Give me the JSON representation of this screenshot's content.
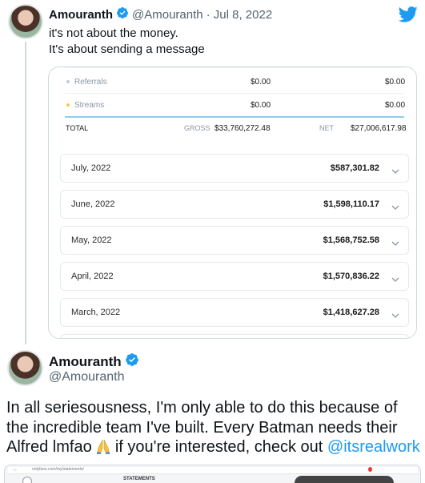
{
  "tweet1": {
    "name": "Amouranth",
    "handle": "@Amouranth",
    "date": "· Jul 8, 2022",
    "text_line1": "it's not about the money.",
    "text_line2": "It's about sending a message"
  },
  "card": {
    "rows": [
      {
        "label": "Referrals",
        "value1": "$0.00",
        "value2": "$0.00",
        "dot_color": "#c6ccd2"
      },
      {
        "label": "Streams",
        "value1": "$0.00",
        "value2": "$0.00",
        "dot_color": "#f4c84d"
      }
    ],
    "total": {
      "label": "TOTAL",
      "gross_label": "GROSS",
      "gross_value": "$33,760,272.48",
      "net_label": "NET",
      "net_value": "$27,006,617.98"
    },
    "months": [
      {
        "label": "July, 2022",
        "value": "$587,301.82"
      },
      {
        "label": "June, 2022",
        "value": "$1,598,110.17"
      },
      {
        "label": "May, 2022",
        "value": "$1,568,752.58"
      },
      {
        "label": "April, 2022",
        "value": "$1,570,836.22"
      },
      {
        "label": "March, 2022",
        "value": "$1,418,627.28"
      }
    ]
  },
  "tweet2": {
    "name": "Amouranth",
    "handle": "@Amouranth",
    "text_part1": "In all seriesousness, I'm only able to do this because of the incredible team I've built. Every Batman needs their Alfred lmfao",
    "text_part2": " if you're interested, check out ",
    "mention": "@itsrealwork"
  },
  "embedded_screenshot": {
    "url": "onlyfans.com/my/statements/",
    "heading": "STATEMENTS"
  },
  "colors": {
    "accent": "#1d9bf0",
    "verified": "#1d9bf0",
    "total_line": "#8ad0f3"
  },
  "icons": {
    "verified": "verified-badge-icon",
    "twitter": "twitter-bird-icon",
    "chevron": "chevron-down-icon",
    "emoji": "folded-hands-emoji"
  }
}
